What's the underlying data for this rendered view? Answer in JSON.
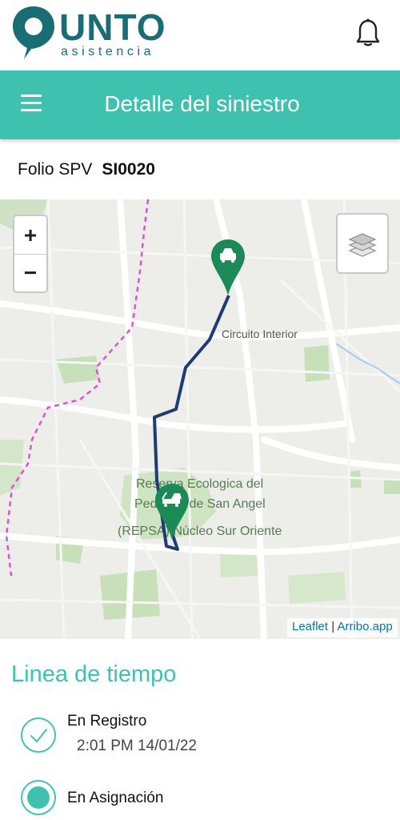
{
  "brand": {
    "name": "UNTO",
    "subtitle": "asistencia",
    "color": "#1a6d75"
  },
  "header": {
    "title": "Detalle del siniestro",
    "color": "#3fc1b0"
  },
  "folio": {
    "label": "Folio SPV",
    "value": "SI0020"
  },
  "map": {
    "labels": {
      "road": "Circuito Interior",
      "reserve_line1": "Reserva Ecologica del",
      "reserve_line2": "Pedregal de San Angel",
      "reserve_line3": "(REPSA) Núcleo Sur Oriente"
    },
    "zoom_in": "+",
    "zoom_out": "−",
    "attribution": {
      "leaflet": "Leaflet",
      "separator": " | ",
      "provider": "Arribo.app"
    },
    "route_color": "#1e3a78",
    "marker_color": "#1b8a57",
    "markers": [
      "car-icon",
      "tow-truck-icon"
    ]
  },
  "timeline": {
    "title": "Linea de tiempo",
    "items": [
      {
        "label": "En Registro",
        "time": "2:01 PM 14/01/22",
        "status": "done"
      },
      {
        "label": "En Asignación",
        "time": "",
        "status": "active"
      }
    ]
  }
}
